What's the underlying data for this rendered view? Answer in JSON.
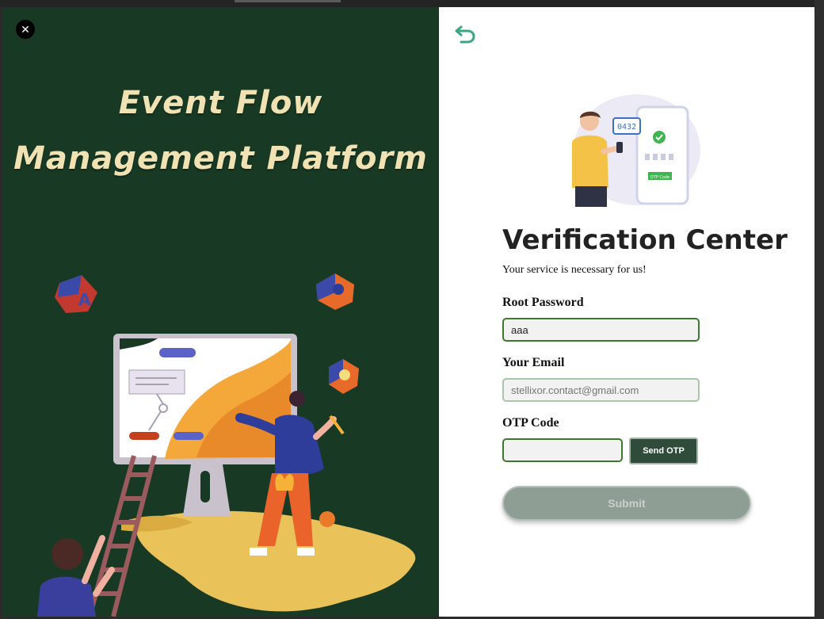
{
  "window": {
    "close_glyph": "✕"
  },
  "brand": {
    "title_line1": "Event Flow",
    "title_line2": "Management Platform"
  },
  "form": {
    "title": "Verification Center",
    "subtitle": "Your service is necessary for us!",
    "hero_otp_digits": "0432",
    "hero_otp_button": "OTP Code",
    "root_password": {
      "label": "Root Password",
      "value": "aaa"
    },
    "email": {
      "label": "Your Email",
      "placeholder": "stellixor.contact@gmail.com",
      "value": ""
    },
    "otp": {
      "label": "OTP Code",
      "value": "",
      "send_label": "Send OTP"
    },
    "submit_label": "Submit",
    "submit_disabled": true
  },
  "colors": {
    "left_bg": "#183a25",
    "title_cream": "#f1e2b4",
    "input_border_active": "#3b7a2c",
    "send_otp_bg": "#2f4b3a",
    "submit_bg": "#8e9e95"
  },
  "icons": {
    "close": "close-icon",
    "back": "back-arrow-icon"
  }
}
